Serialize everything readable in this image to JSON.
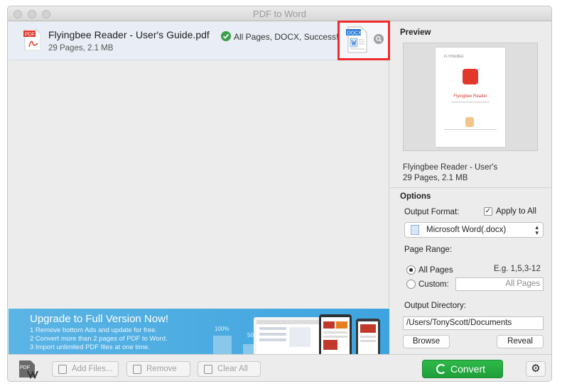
{
  "window": {
    "title": "PDF to Word"
  },
  "file_list": {
    "items": [
      {
        "name": "Flyingbee Reader - User's Guide.pdf",
        "meta": "29 Pages, 2.1 MB",
        "status": "All Pages, DOCX, Success!",
        "source_badge": "PDF",
        "output_badge": "DOCX"
      }
    ]
  },
  "banner": {
    "title": "Upgrade to Full Version Now!",
    "lines": [
      "1 Remove bottom Ads and update for free.",
      "2 Convert more than 2 pages of PDF to Word.",
      "3 Import unlimited PDF files at one time."
    ],
    "pct_full": "100%",
    "pct_half": "50"
  },
  "preview": {
    "section_title": "Preview",
    "thumb_logo": "FLYINGBEE",
    "thumb_title": "Flyingbee Reader",
    "name": "Flyingbee Reader - User's",
    "meta": "29 Pages, 2.1 MB"
  },
  "options": {
    "section_title": "Options",
    "output_format_label": "Output Format:",
    "apply_to_all_label": "Apply to All",
    "apply_to_all_checked": true,
    "format_selected": "Microsoft Word(.docx)",
    "page_range_label": "Page Range:",
    "all_pages_label": "All Pages",
    "example_hint": "E.g. 1,5,3-12",
    "custom_label": "Custom:",
    "custom_placeholder": "All Pages",
    "output_directory_label": "Output Directory:",
    "output_directory_value": "/Users/TonyScott/Documents",
    "browse_label": "Browse",
    "reveal_label": "Reveal"
  },
  "toolbar": {
    "app_badge": "PDF",
    "add_files_label": "Add Files...",
    "remove_label": "Remove",
    "clear_all_label": "Clear All",
    "convert_label": "Convert"
  },
  "colors": {
    "accent_green": "#2fb94a",
    "highlight_red": "#f02d2d",
    "banner_blue": "#4aace2",
    "pdf_red": "#e3372c"
  }
}
